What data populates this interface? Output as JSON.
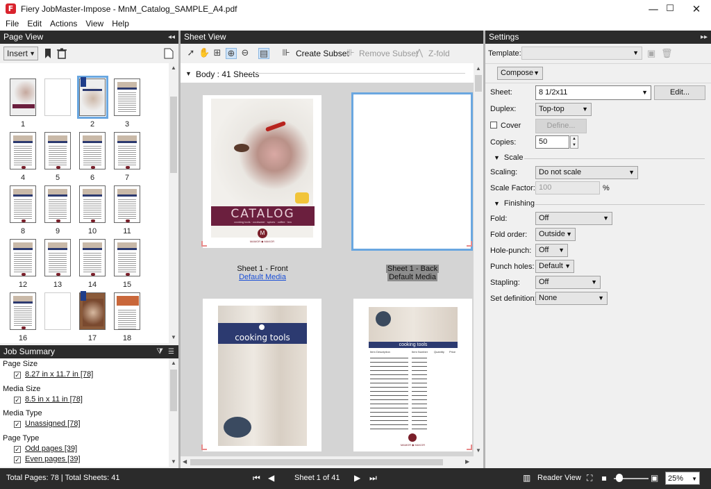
{
  "window": {
    "logo_glyph": "F",
    "title": "Fiery JobMaster-Impose -   MnM_Catalog_SAMPLE_A4.pdf",
    "minimize_glyph": "—",
    "maximize_glyph": "☐",
    "close_glyph": "✕"
  },
  "menu": [
    "File",
    "Edit",
    "Actions",
    "View",
    "Help"
  ],
  "page_view": {
    "title": "Page View",
    "collapse_glyph": "◂◂",
    "insert_label": "Insert",
    "pages": [
      "1",
      "2",
      "3",
      "4",
      "5",
      "6",
      "7",
      "8",
      "9",
      "10",
      "11",
      "12",
      "13",
      "14",
      "15",
      "16",
      "17",
      "18"
    ],
    "selected_page": "2"
  },
  "job_summary": {
    "title": "Job Summary",
    "sections": [
      {
        "label": "Page Size",
        "items": [
          "8.27 in x 11.7 in [78]"
        ]
      },
      {
        "label": "Media Size",
        "items": [
          "8.5 in x 11 in [78]"
        ]
      },
      {
        "label": "Media Type",
        "items": [
          "Unassigned [78]"
        ]
      },
      {
        "label": "Page Type",
        "items": [
          "Odd pages [39]",
          "Even pages [39]"
        ]
      }
    ]
  },
  "sheet_view": {
    "title": "Sheet View",
    "create_subset": "Create Subset",
    "remove_subset": "Remove Subset",
    "z_fold": "Z-fold",
    "body_label": "Body : 41 Sheets",
    "front_caption": "Sheet 1 - Front",
    "front_media": "Default Media",
    "back_caption": "Sheet 1 - Back",
    "back_media": "Default Media",
    "catalog_title": "CATALOG",
    "catalog_sub": "cooking tools   ·   cookware   ·   spices   ·   coffee   ·   tea",
    "brand_name": "MAMOR ◆ MAKOR",
    "cooking_tools_title": "cooking tools",
    "table_headers": [
      "Item Description",
      "Item Number",
      "Quantity",
      "Price"
    ]
  },
  "settings": {
    "title": "Settings",
    "template_label": "Template:",
    "template_value": "",
    "compose_label": "Compose",
    "sheet_label": "Sheet:",
    "sheet_value": "8 1/2x11",
    "edit_button": "Edit...",
    "duplex_label": "Duplex:",
    "duplex_value": "Top-top",
    "cover_label": "Cover",
    "define_button": "Define...",
    "copies_label": "Copies:",
    "copies_value": "50",
    "scale_section": "Scale",
    "scaling_label": "Scaling:",
    "scaling_value": "Do not scale",
    "scale_factor_label": "Scale Factor:",
    "scale_factor_value": "100",
    "percent": "%",
    "finishing_section": "Finishing",
    "fold_label": "Fold:",
    "fold_value": "Off",
    "fold_order_label": "Fold order:",
    "fold_order_value": "Outside",
    "hole_punch_label": "Hole-punch:",
    "hole_punch_value": "Off",
    "punch_holes_label": "Punch holes:",
    "punch_holes_value": "Default",
    "stapling_label": "Stapling:",
    "stapling_value": "Off",
    "set_definition_label": "Set definition:",
    "set_definition_value": "None"
  },
  "status": {
    "totals": "Total Pages: 78 | Total Sheets: 41",
    "sheet_position": "Sheet 1 of 41",
    "reader_view": "Reader View",
    "zoom": "25%"
  },
  "colors": {
    "panel_header": "#2b2b2b",
    "selection": "#6aa7e0",
    "catalog_band": "#6b1f3e",
    "navy_band": "#2c3a70",
    "link": "#1a4fd6"
  }
}
